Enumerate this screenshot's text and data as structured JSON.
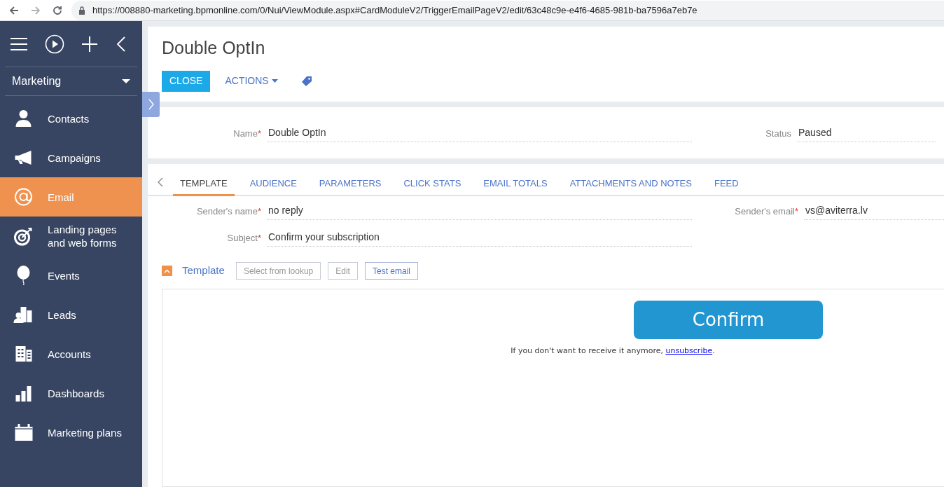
{
  "browser": {
    "url": "https://008880-marketing.bpmonline.com/0/Nui/ViewModule.aspx#CardModuleV2/TriggerEmailPageV2/edit/63c48c9e-e4f6-4685-981b-ba7596a7eb7e"
  },
  "sidebar": {
    "workplace": "Marketing",
    "items": [
      {
        "label": "Contacts",
        "selected": false
      },
      {
        "label": "Campaigns",
        "selected": false
      },
      {
        "label": "Email",
        "selected": true
      },
      {
        "label": "Landing pages and web forms",
        "selected": false
      },
      {
        "label": "Events",
        "selected": false
      },
      {
        "label": "Leads",
        "selected": false
      },
      {
        "label": "Accounts",
        "selected": false
      },
      {
        "label": "Dashboards",
        "selected": false
      },
      {
        "label": "Marketing plans",
        "selected": false
      }
    ]
  },
  "page": {
    "title": "Double OptIn",
    "buttons": [
      {
        "label": "CLOSE",
        "kind": "primary"
      },
      {
        "label": "ACTIONS",
        "kind": "menu"
      },
      {
        "kind": "tag"
      }
    ]
  },
  "header_fields": [
    {
      "label": "Name",
      "required_mark": "*",
      "value": "Double OptIn"
    },
    {
      "label": "Status",
      "value": "Paused"
    }
  ],
  "tabs": [
    {
      "label": "TEMPLATE",
      "selected": true
    },
    {
      "label": "AUDIENCE",
      "selected": false
    },
    {
      "label": "PARAMETERS",
      "selected": false
    },
    {
      "label": "CLICK STATS",
      "selected": false
    },
    {
      "label": "EMAIL TOTALS",
      "selected": false
    },
    {
      "label": "ATTACHMENTS AND NOTES",
      "selected": false
    },
    {
      "label": "FEED",
      "selected": false
    }
  ],
  "tab_fields": [
    {
      "label": "Sender's name",
      "required_mark": "*",
      "value": "no reply"
    },
    {
      "label": "Sender's email",
      "required_mark": "*",
      "value": "vs@aviterra.lv"
    },
    {
      "label": "Subject",
      "required_mark": "*",
      "value": "Confirm your subscription"
    }
  ],
  "template": {
    "title": "Template",
    "expanded": true,
    "buttons": [
      {
        "label": "Select from lookup",
        "disabled": true
      },
      {
        "label": "Edit",
        "disabled": true
      },
      {
        "label": "Test email",
        "disabled": false
      }
    ],
    "preview": {
      "button": "Confirm",
      "footer_text": "If you don't want to receive it anymore, ",
      "footer_link": "unsubscribe",
      "footer_end": "."
    }
  }
}
